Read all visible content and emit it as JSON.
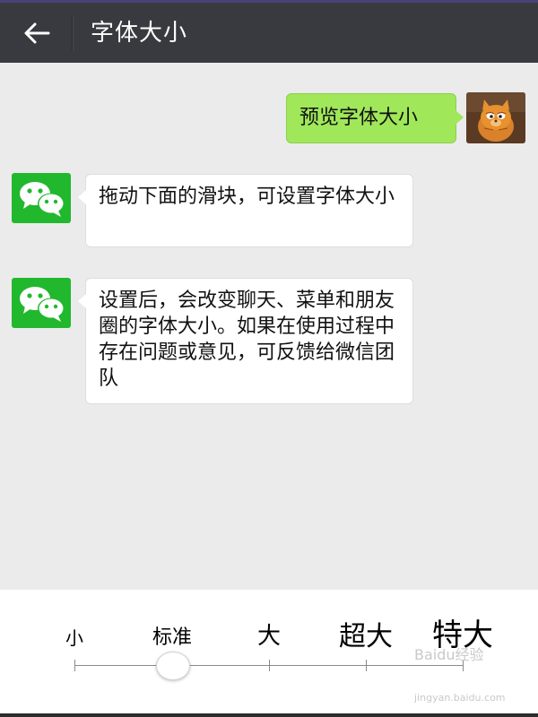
{
  "header": {
    "title": "字体大小"
  },
  "chat": {
    "outgoing": {
      "text": "预览字体大小"
    },
    "incoming": [
      {
        "text": "拖动下面的滑块，可设置字体大小"
      },
      {
        "text": "设置后，会改变聊天、菜单和朋友圈的字体大小。如果在使用过程中存在问题或意见，可反馈给微信团队"
      }
    ]
  },
  "font_size": {
    "options": [
      "小",
      "标准",
      "大",
      "超大",
      "特大"
    ],
    "selected_index": 1,
    "selected": "标准"
  },
  "watermark": {
    "text": "Baidu经验",
    "url": "jingyan.baidu.com"
  },
  "colors": {
    "header_bg": "#393a3f",
    "chat_bg": "#ebebeb",
    "outgoing_bubble": "#a0e75a",
    "incoming_bubble": "#ffffff",
    "wechat_green": "#21b82e"
  },
  "icons": {
    "back": "arrow-left-icon",
    "incoming_avatar": "wechat-logo-icon",
    "user_avatar": "cat-avatar-icon"
  }
}
